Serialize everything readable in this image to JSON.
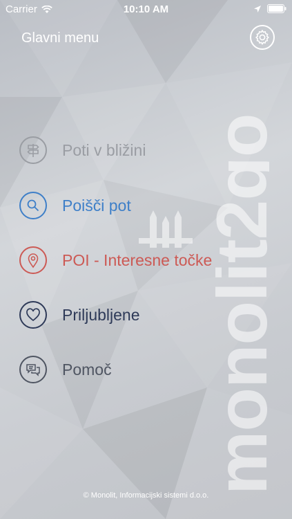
{
  "status_bar": {
    "carrier": "Carrier",
    "time": "10:10 AM",
    "icons": [
      "wifi-icon",
      "location-arrow-icon",
      "battery-icon"
    ]
  },
  "header": {
    "title": "Glavni menu",
    "settings_icon": "gear-icon"
  },
  "brand": {
    "text": "monolit2go"
  },
  "menu": {
    "items": [
      {
        "label": "Poti v bližini",
        "icon": "signpost-icon",
        "color": "#9a9da3"
      },
      {
        "label": "Poišči pot",
        "icon": "search-icon",
        "color": "#3e7fc8"
      },
      {
        "label": "POI - Interesne točke",
        "icon": "location-pin-icon",
        "color": "#cc5a55"
      },
      {
        "label": "Priljubljene",
        "icon": "heart-icon",
        "color": "#2e3a58"
      },
      {
        "label": "Pomoč",
        "icon": "chat-bubbles-icon",
        "color": "#4f5562"
      }
    ]
  },
  "footer": {
    "copyright": "© Monolit, Informacijski sistemi d.o.o."
  }
}
